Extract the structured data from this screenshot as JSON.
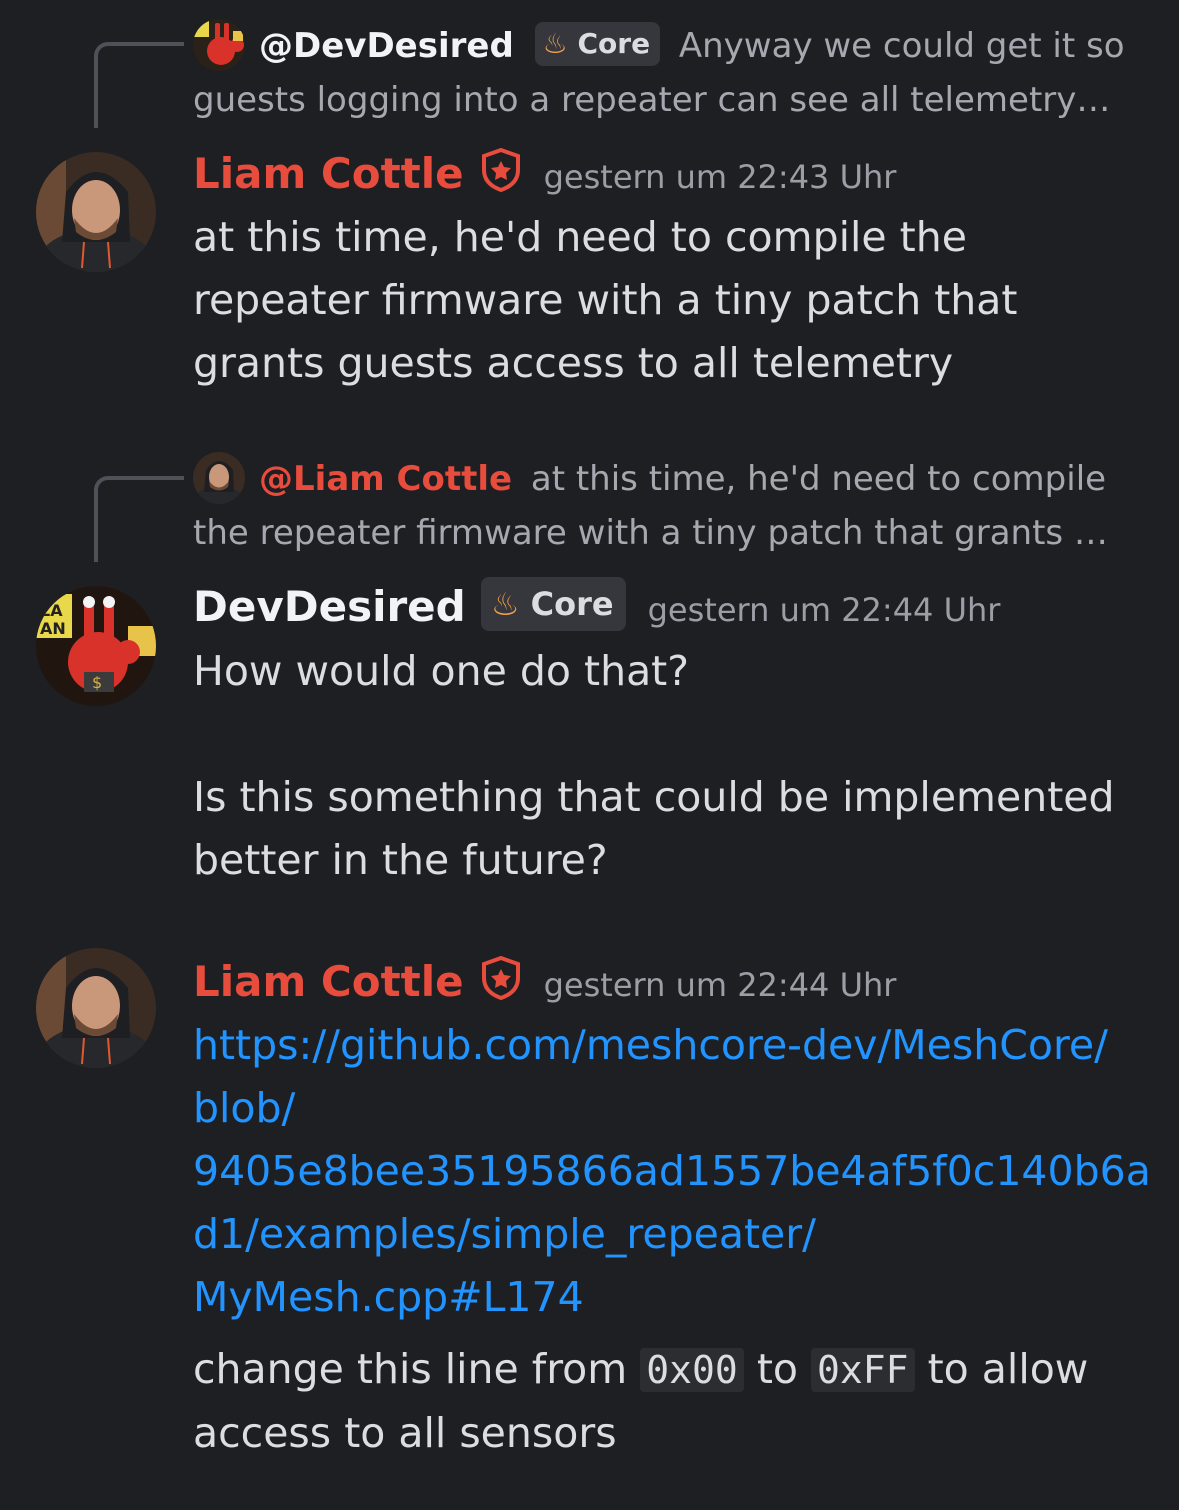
{
  "messages": [
    {
      "reply": {
        "name": "@DevDesired",
        "tag": "Core",
        "text_line1": "Anyway we could get it so",
        "text_line2": "guests logging into a repeater can see all telemetry…"
      },
      "author": "Liam Cottle",
      "timestamp": "gestern um 22:43 Uhr",
      "text": "at this time, he'd need to compile the repeater firmware with a tiny patch that grants guests access to all telemetry"
    },
    {
      "reply": {
        "name": "@Liam Cottle",
        "text_line1": "at this time, he'd need to compile",
        "text_line2": "the repeater firmware with a tiny patch that grants …"
      },
      "author": "DevDesired",
      "tag": "Core",
      "timestamp": "gestern um 22:44 Uhr",
      "text_p1": "How would one do that?",
      "text_p2": "Is this something that could be implemented better in the future?"
    },
    {
      "author": "Liam Cottle",
      "timestamp": "gestern um 22:44 Uhr",
      "link": "https://github.com/meshcore-dev/MeshCore/blob/9405e8bee35195866ad1557be4af5f0c140b6ad1/examples/simple_repeater/MyMesh.cpp#L174",
      "link_lines": [
        "https://github.com/meshcore-dev/MeshCore/",
        "blob/",
        "9405e8bee35195866ad1557be4af5f0c140b6a",
        "d1/examples/simple_repeater/",
        "MyMesh.cpp#L174"
      ],
      "text_before": "change this line from",
      "code1": "0x00",
      "text_mid": "to",
      "code2": "0xFF",
      "text_after": "to allow access to all sensors"
    }
  ],
  "colors": {
    "background": "#1e1f23",
    "mod_red": "#e74c3c",
    "link": "#2294ff",
    "muted": "#a6a8b0"
  }
}
